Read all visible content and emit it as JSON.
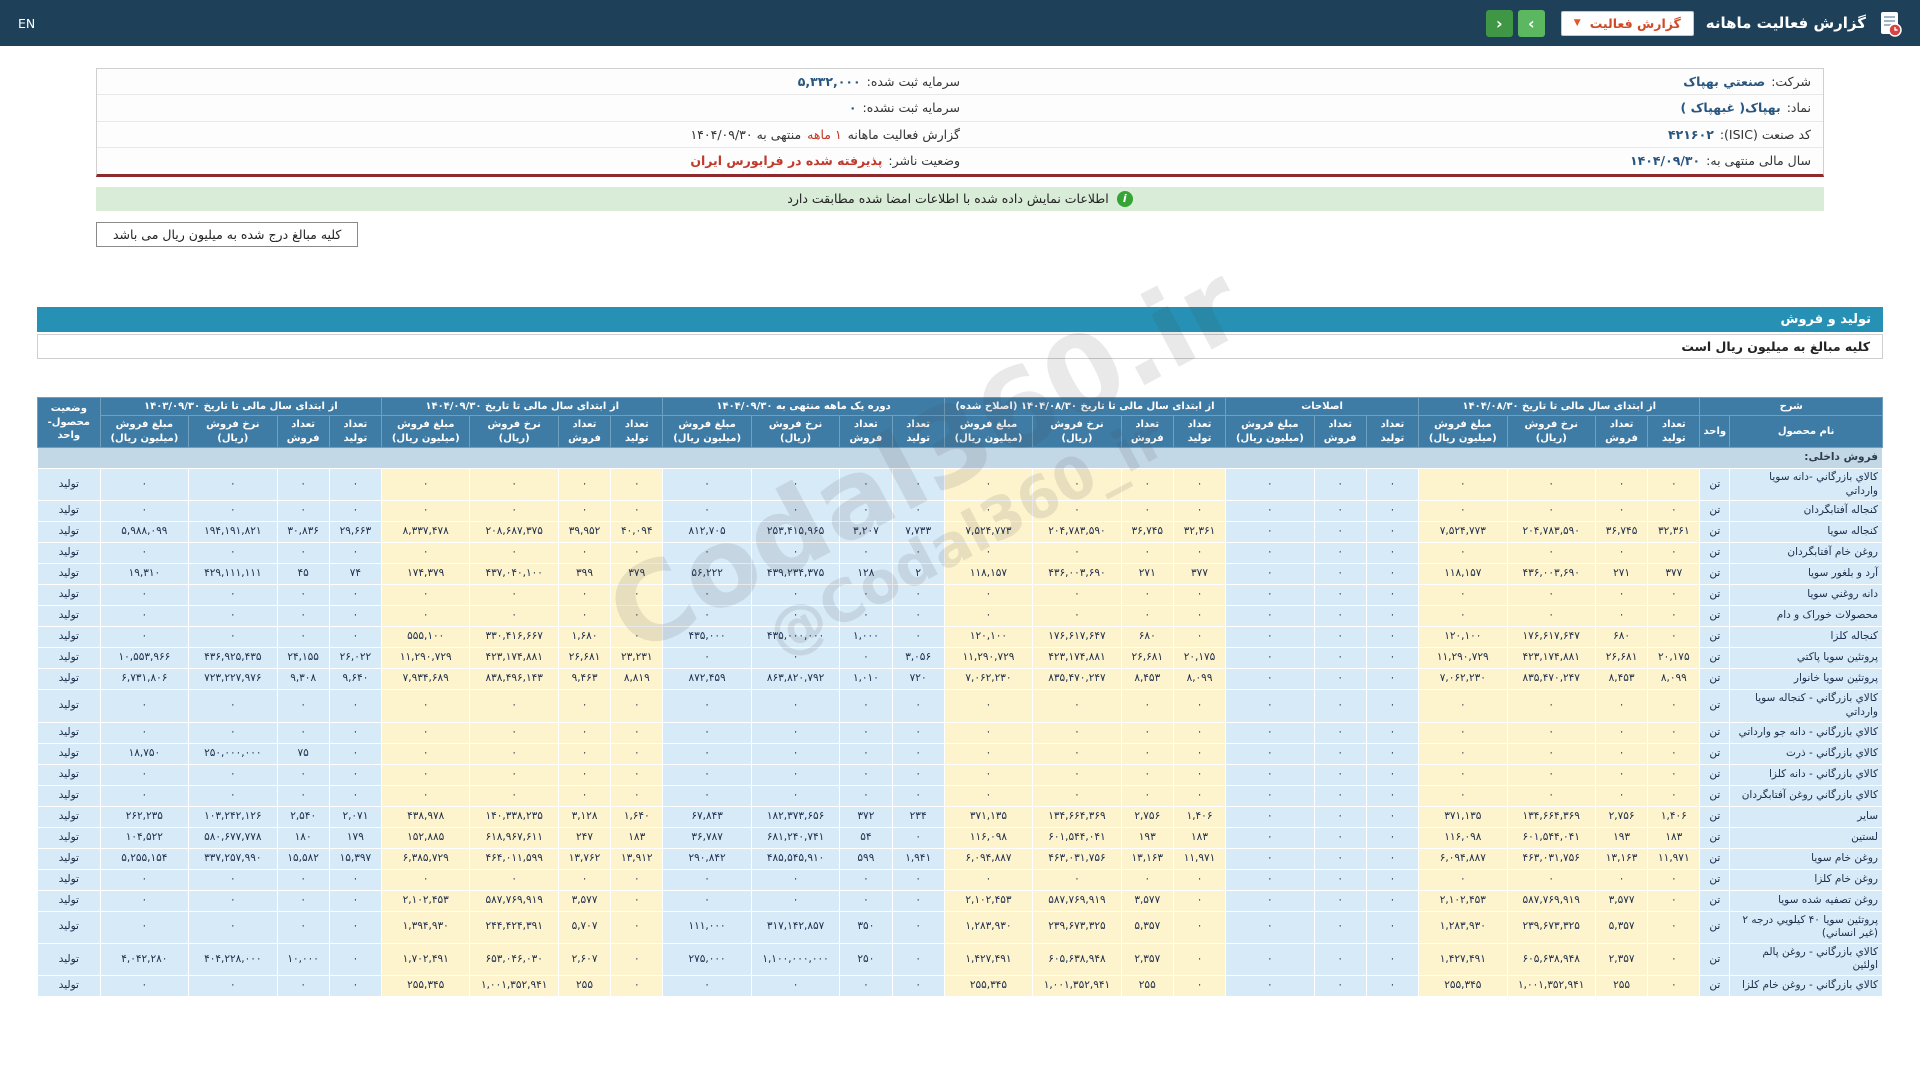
{
  "top_bar": {
    "lang": "EN",
    "title": "گزارش فعالیت ماهانه",
    "dropdown_label": "گزارش فعالیت",
    "dropdown_caret": "▼",
    "nav_next": "›",
    "nav_prev": "‹"
  },
  "company": {
    "rows": [
      {
        "right": {
          "label": "شرکت:",
          "value": "صنعتي بهپاک"
        },
        "left": {
          "label": "سرمایه ثبت شده:",
          "value": "۵,۳۳۲,۰۰۰"
        }
      },
      {
        "right": {
          "label": "نماد:",
          "value": "بهپاک( غبهپاک )"
        },
        "left": {
          "label": "سرمایه ثبت نشده:",
          "value": "۰"
        }
      },
      {
        "right": {
          "label": "کد صنعت (ISIC):",
          "value": "۴۲۱۶۰۲"
        },
        "left": {
          "label": "گزارش فعالیت ماهانه",
          "period": "۱ ماهه",
          "value2": "منتهی به ۱۴۰۴/۰۹/۳۰"
        }
      },
      {
        "right": {
          "label": "سال مالی منتهی به:",
          "value": "۱۴۰۴/۰۹/۳۰"
        },
        "left": {
          "label": "وضعیت ناشر:",
          "value": "پذيرفته شده در فرابورس ايران"
        }
      }
    ]
  },
  "notices": {
    "signed": "اطلاعات نمایش داده شده با اطلاعات امضا شده مطابقت دارد",
    "info_icon": "i",
    "amounts_box": "کلیه مبالغ درج شده به میلیون ریال می باشد"
  },
  "section": {
    "title": "تولید و فروش",
    "amounts_note": "کلیه مبالغ به میلیون ریال است"
  },
  "watermark": {
    "line1": "Codal360.ir",
    "line2": "@Codal360_ir"
  },
  "table": {
    "caption_col": {
      "top": "شرح",
      "name": "نام محصول",
      "unit": "واحد"
    },
    "status_col": "وضعیت محصول-واحد",
    "section_row": "فروش داخلی:",
    "groups": [
      {
        "label": "از ابتدای سال مالی تا تاریخ ۱۴۰۴/۰۸/۳۰",
        "tone": "cream",
        "cols": [
          "تعداد تولید",
          "تعداد فروش",
          "نرخ فروش (ریال)",
          "مبلغ فروش (میلیون ریال)"
        ]
      },
      {
        "label": "اصلاحات",
        "tone": "blue",
        "cols": [
          "تعداد تولید",
          "تعداد فروش",
          "مبلغ فروش (میلیون ریال)"
        ]
      },
      {
        "label": "از ابتدای سال مالی تا تاریخ ۱۴۰۴/۰۸/۳۰ (اصلاح شده)",
        "tone": "cream",
        "cols": [
          "تعداد تولید",
          "تعداد فروش",
          "نرخ فروش (ریال)",
          "مبلغ فروش (میلیون ریال)"
        ]
      },
      {
        "label": "دوره یک ماهه منتهی به ۱۴۰۴/۰۹/۳۰",
        "tone": "blue",
        "cols": [
          "تعداد تولید",
          "تعداد فروش",
          "نرخ فروش (ریال)",
          "مبلغ فروش (میلیون ریال)"
        ]
      },
      {
        "label": "از ابتدای سال مالی تا تاریخ ۱۴۰۴/۰۹/۳۰",
        "tone": "cream",
        "cols": [
          "تعداد تولید",
          "تعداد فروش",
          "نرخ فروش (ریال)",
          "مبلغ فروش (میلیون ریال)"
        ]
      },
      {
        "label": "از ابتدای سال مالی تا تاریخ ۱۴۰۳/۰۹/۳۰",
        "tone": "blue",
        "cols": [
          "تعداد تولید",
          "تعداد فروش",
          "نرخ فروش (ریال)",
          "مبلغ فروش (میلیون ریال)"
        ]
      }
    ],
    "rows": [
      {
        "name": "کالاي بازرگاني -دانه سويا وارداتي",
        "unit": "تن",
        "status": "تولید",
        "values": [
          "۰",
          "۰",
          "۰",
          "۰",
          "۰",
          "۰",
          "۰",
          "۰",
          "۰",
          "۰",
          "۰",
          "۰",
          "۰",
          "۰",
          "۰",
          "۰",
          "۰",
          "۰",
          "۰",
          "۰",
          "۰",
          "۰",
          "۰"
        ]
      },
      {
        "name": "کنجاله آفتابگردان",
        "unit": "تن",
        "status": "تولید",
        "values": [
          "۰",
          "۰",
          "۰",
          "۰",
          "۰",
          "۰",
          "۰",
          "۰",
          "۰",
          "۰",
          "۰",
          "۰",
          "۰",
          "۰",
          "۰",
          "۰",
          "۰",
          "۰",
          "۰",
          "۰",
          "۰",
          "۰",
          "۰"
        ]
      },
      {
        "name": "کنجاله سويا",
        "unit": "تن",
        "status": "تولید",
        "values": [
          "۳۲,۳۶۱",
          "۳۶,۷۴۵",
          "۲۰۴,۷۸۳,۵۹۰",
          "۷,۵۲۴,۷۷۳",
          "۰",
          "۰",
          "۰",
          "۳۲,۳۶۱",
          "۳۶,۷۴۵",
          "۲۰۴,۷۸۳,۵۹۰",
          "۷,۵۲۴,۷۷۳",
          "۷,۷۳۳",
          "۳,۲۰۷",
          "۲۵۳,۴۱۵,۹۶۵",
          "۸۱۲,۷۰۵",
          "۴۰,۰۹۴",
          "۳۹,۹۵۲",
          "۲۰۸,۶۸۷,۳۷۵",
          "۸,۳۳۷,۴۷۸",
          "۲۹,۶۶۳",
          "۳۰,۸۳۶",
          "۱۹۴,۱۹۱,۸۲۱",
          "۵,۹۸۸,۰۹۹"
        ]
      },
      {
        "name": "روغن خام آفتابگردان",
        "unit": "تن",
        "status": "تولید",
        "values": [
          "۰",
          "۰",
          "۰",
          "۰",
          "۰",
          "۰",
          "۰",
          "۰",
          "۰",
          "۰",
          "۰",
          "۰",
          "۰",
          "۰",
          "۰",
          "۰",
          "۰",
          "۰",
          "۰",
          "۰",
          "۰",
          "۰",
          "۰"
        ]
      },
      {
        "name": "آرد و بلغور سويا",
        "unit": "تن",
        "status": "تولید",
        "values": [
          "۳۷۷",
          "۲۷۱",
          "۴۳۶,۰۰۳,۶۹۰",
          "۱۱۸,۱۵۷",
          "۰",
          "۰",
          "۰",
          "۳۷۷",
          "۲۷۱",
          "۴۳۶,۰۰۳,۶۹۰",
          "۱۱۸,۱۵۷",
          "۲",
          "۱۲۸",
          "۴۳۹,۲۳۴,۳۷۵",
          "۵۶,۲۲۲",
          "۳۷۹",
          "۳۹۹",
          "۴۳۷,۰۴۰,۱۰۰",
          "۱۷۴,۳۷۹",
          "۷۴",
          "۴۵",
          "۴۲۹,۱۱۱,۱۱۱",
          "۱۹,۳۱۰"
        ]
      },
      {
        "name": "دانه روغني سويا",
        "unit": "تن",
        "status": "تولید",
        "values": [
          "۰",
          "۰",
          "۰",
          "۰",
          "۰",
          "۰",
          "۰",
          "۰",
          "۰",
          "۰",
          "۰",
          "۰",
          "۰",
          "۰",
          "۰",
          "۰",
          "۰",
          "۰",
          "۰",
          "۰",
          "۰",
          "۰",
          "۰"
        ]
      },
      {
        "name": "محصولات خوراک و دام",
        "unit": "تن",
        "status": "تولید",
        "values": [
          "۰",
          "۰",
          "۰",
          "۰",
          "۰",
          "۰",
          "۰",
          "۰",
          "۰",
          "۰",
          "۰",
          "۰",
          "۰",
          "۰",
          "۰",
          "۰",
          "۰",
          "۰",
          "۰",
          "۰",
          "۰",
          "۰",
          "۰"
        ]
      },
      {
        "name": "کنجاله کلزا",
        "unit": "تن",
        "status": "تولید",
        "values": [
          "۰",
          "۶۸۰",
          "۱۷۶,۶۱۷,۶۴۷",
          "۱۲۰,۱۰۰",
          "۰",
          "۰",
          "۰",
          "۰",
          "۶۸۰",
          "۱۷۶,۶۱۷,۶۴۷",
          "۱۲۰,۱۰۰",
          "۰",
          "۱,۰۰۰",
          "۴۳۵,۰۰۰,۰۰۰",
          "۴۳۵,۰۰۰",
          "۰",
          "۱,۶۸۰",
          "۳۳۰,۴۱۶,۶۶۷",
          "۵۵۵,۱۰۰",
          "۰",
          "۰",
          "۰",
          "۰"
        ]
      },
      {
        "name": "پروتئين سويا پاکتي",
        "unit": "تن",
        "status": "تولید",
        "values": [
          "۲۰,۱۷۵",
          "۲۶,۶۸۱",
          "۴۲۳,۱۷۴,۸۸۱",
          "۱۱,۲۹۰,۷۲۹",
          "۰",
          "۰",
          "۰",
          "۲۰,۱۷۵",
          "۲۶,۶۸۱",
          "۴۲۳,۱۷۴,۸۸۱",
          "۱۱,۲۹۰,۷۲۹",
          "۳,۰۵۶",
          "۰",
          "۰",
          "۰",
          "۲۳,۲۳۱",
          "۲۶,۶۸۱",
          "۴۲۳,۱۷۴,۸۸۱",
          "۱۱,۲۹۰,۷۲۹",
          "۲۶,۰۲۲",
          "۲۴,۱۵۵",
          "۴۳۶,۹۲۵,۴۳۵",
          "۱۰,۵۵۳,۹۶۶"
        ]
      },
      {
        "name": "پروتئين سويا خانوار",
        "unit": "تن",
        "status": "تولید",
        "values": [
          "۸,۰۹۹",
          "۸,۴۵۳",
          "۸۳۵,۴۷۰,۲۴۷",
          "۷,۰۶۲,۲۳۰",
          "۰",
          "۰",
          "۰",
          "۸,۰۹۹",
          "۸,۴۵۳",
          "۸۳۵,۴۷۰,۲۴۷",
          "۷,۰۶۲,۲۳۰",
          "۷۲۰",
          "۱,۰۱۰",
          "۸۶۳,۸۲۰,۷۹۲",
          "۸۷۲,۴۵۹",
          "۸,۸۱۹",
          "۹,۴۶۳",
          "۸۳۸,۴۹۶,۱۴۳",
          "۷,۹۳۴,۶۸۹",
          "۹,۶۴۰",
          "۹,۳۰۸",
          "۷۲۳,۲۲۷,۹۷۶",
          "۶,۷۳۱,۸۰۶"
        ]
      },
      {
        "name": "کالاي بازرگاني - کنجاله سويا وارداتي",
        "unit": "تن",
        "status": "تولید",
        "values": [
          "۰",
          "۰",
          "۰",
          "۰",
          "۰",
          "۰",
          "۰",
          "۰",
          "۰",
          "۰",
          "۰",
          "۰",
          "۰",
          "۰",
          "۰",
          "۰",
          "۰",
          "۰",
          "۰",
          "۰",
          "۰",
          "۰",
          "۰"
        ]
      },
      {
        "name": "کالاي بازرگاني - دانه جو وارداتي",
        "unit": "تن",
        "status": "تولید",
        "values": [
          "۰",
          "۰",
          "۰",
          "۰",
          "۰",
          "۰",
          "۰",
          "۰",
          "۰",
          "۰",
          "۰",
          "۰",
          "۰",
          "۰",
          "۰",
          "۰",
          "۰",
          "۰",
          "۰",
          "۰",
          "۰",
          "۰",
          "۰"
        ]
      },
      {
        "name": "کالاي بازرگاني - ذرت",
        "unit": "تن",
        "status": "تولید",
        "values": [
          "۰",
          "۰",
          "۰",
          "۰",
          "۰",
          "۰",
          "۰",
          "۰",
          "۰",
          "۰",
          "۰",
          "۰",
          "۰",
          "۰",
          "۰",
          "۰",
          "۰",
          "۰",
          "۰",
          "۰",
          "۷۵",
          "۲۵۰,۰۰۰,۰۰۰",
          "۱۸,۷۵۰"
        ]
      },
      {
        "name": "کالاي بازرگاني - دانه کلزا",
        "unit": "تن",
        "status": "تولید",
        "values": [
          "۰",
          "۰",
          "۰",
          "۰",
          "۰",
          "۰",
          "۰",
          "۰",
          "۰",
          "۰",
          "۰",
          "۰",
          "۰",
          "۰",
          "۰",
          "۰",
          "۰",
          "۰",
          "۰",
          "۰",
          "۰",
          "۰",
          "۰"
        ]
      },
      {
        "name": "کالاي بازرگاني روغن آفتابگردان",
        "unit": "تن",
        "status": "تولید",
        "values": [
          "۰",
          "۰",
          "۰",
          "۰",
          "۰",
          "۰",
          "۰",
          "۰",
          "۰",
          "۰",
          "۰",
          "۰",
          "۰",
          "۰",
          "۰",
          "۰",
          "۰",
          "۰",
          "۰",
          "۰",
          "۰",
          "۰",
          "۰"
        ]
      },
      {
        "name": "ساير",
        "unit": "تن",
        "status": "تولید",
        "values": [
          "۱,۴۰۶",
          "۲,۷۵۶",
          "۱۳۴,۶۶۴,۳۶۹",
          "۳۷۱,۱۳۵",
          "۰",
          "۰",
          "۰",
          "۱,۴۰۶",
          "۲,۷۵۶",
          "۱۳۴,۶۶۴,۳۶۹",
          "۳۷۱,۱۳۵",
          "۲۳۴",
          "۳۷۲",
          "۱۸۲,۳۷۳,۶۵۶",
          "۶۷,۸۴۳",
          "۱,۶۴۰",
          "۳,۱۲۸",
          "۱۴۰,۳۳۸,۲۳۵",
          "۴۳۸,۹۷۸",
          "۲,۰۷۱",
          "۲,۵۴۰",
          "۱۰۳,۲۴۲,۱۲۶",
          "۲۶۲,۲۳۵"
        ]
      },
      {
        "name": "لستين",
        "unit": "تن",
        "status": "تولید",
        "values": [
          "۱۸۳",
          "۱۹۳",
          "۶۰۱,۵۴۴,۰۴۱",
          "۱۱۶,۰۹۸",
          "۰",
          "۰",
          "۰",
          "۱۸۳",
          "۱۹۳",
          "۶۰۱,۵۴۴,۰۴۱",
          "۱۱۶,۰۹۸",
          "۰",
          "۵۴",
          "۶۸۱,۲۴۰,۷۴۱",
          "۳۶,۷۸۷",
          "۱۸۳",
          "۲۴۷",
          "۶۱۸,۹۶۷,۶۱۱",
          "۱۵۲,۸۸۵",
          "۱۷۹",
          "۱۸۰",
          "۵۸۰,۶۷۷,۷۷۸",
          "۱۰۴,۵۲۲"
        ]
      },
      {
        "name": "روغن خام سويا",
        "unit": "تن",
        "status": "تولید",
        "values": [
          "۱۱,۹۷۱",
          "۱۳,۱۶۳",
          "۴۶۳,۰۳۱,۷۵۶",
          "۶,۰۹۴,۸۸۷",
          "۰",
          "۰",
          "۰",
          "۱۱,۹۷۱",
          "۱۳,۱۶۳",
          "۴۶۳,۰۳۱,۷۵۶",
          "۶,۰۹۴,۸۸۷",
          "۱,۹۴۱",
          "۵۹۹",
          "۴۸۵,۵۴۵,۹۱۰",
          "۲۹۰,۸۴۲",
          "۱۳,۹۱۲",
          "۱۳,۷۶۲",
          "۴۶۴,۰۱۱,۵۹۹",
          "۶,۳۸۵,۷۲۹",
          "۱۵,۳۹۷",
          "۱۵,۵۸۲",
          "۳۳۷,۲۵۷,۹۹۰",
          "۵,۲۵۵,۱۵۴"
        ]
      },
      {
        "name": "روغن خام کلزا",
        "unit": "تن",
        "status": "تولید",
        "values": [
          "۰",
          "۰",
          "۰",
          "۰",
          "۰",
          "۰",
          "۰",
          "۰",
          "۰",
          "۰",
          "۰",
          "۰",
          "۰",
          "۰",
          "۰",
          "۰",
          "۰",
          "۰",
          "۰",
          "۰",
          "۰",
          "۰",
          "۰"
        ]
      },
      {
        "name": "روغن تصفيه شده سويا",
        "unit": "تن",
        "status": "تولید",
        "values": [
          "۰",
          "۳,۵۷۷",
          "۵۸۷,۷۶۹,۹۱۹",
          "۲,۱۰۲,۴۵۳",
          "۰",
          "۰",
          "۰",
          "۰",
          "۳,۵۷۷",
          "۵۸۷,۷۶۹,۹۱۹",
          "۲,۱۰۲,۴۵۳",
          "۰",
          "۰",
          "۰",
          "۰",
          "۰",
          "۳,۵۷۷",
          "۵۸۷,۷۶۹,۹۱۹",
          "۲,۱۰۲,۴۵۳",
          "۰",
          "۰",
          "۰",
          "۰"
        ]
      },
      {
        "name": "پروتئين سويا ۴۰ کيلويي درجه ۲ (غير انساني)",
        "unit": "تن",
        "status": "تولید",
        "values": [
          "۰",
          "۵,۳۵۷",
          "۲۳۹,۶۷۳,۳۲۵",
          "۱,۲۸۳,۹۳۰",
          "۰",
          "۰",
          "۰",
          "۰",
          "۵,۳۵۷",
          "۲۳۹,۶۷۳,۳۲۵",
          "۱,۲۸۳,۹۳۰",
          "۰",
          "۳۵۰",
          "۳۱۷,۱۴۲,۸۵۷",
          "۱۱۱,۰۰۰",
          "۰",
          "۵,۷۰۷",
          "۲۴۴,۴۲۴,۳۹۱",
          "۱,۳۹۴,۹۳۰",
          "۰",
          "۰",
          "۰",
          "۰"
        ]
      },
      {
        "name": "کالاي بازرگاني - روغن پالم اولئين",
        "unit": "تن",
        "status": "تولید",
        "values": [
          "۰",
          "۲,۳۵۷",
          "۶۰۵,۶۳۸,۹۴۸",
          "۱,۴۲۷,۴۹۱",
          "۰",
          "۰",
          "۰",
          "۰",
          "۲,۳۵۷",
          "۶۰۵,۶۳۸,۹۴۸",
          "۱,۴۲۷,۴۹۱",
          "۰",
          "۲۵۰",
          "۱,۱۰۰,۰۰۰,۰۰۰",
          "۲۷۵,۰۰۰",
          "۰",
          "۲,۶۰۷",
          "۶۵۳,۰۴۶,۰۳۰",
          "۱,۷۰۲,۴۹۱",
          "۰",
          "۱۰,۰۰۰",
          "۴۰۴,۲۲۸,۰۰۰",
          "۴,۰۴۲,۲۸۰"
        ]
      },
      {
        "name": "کالاي بازرگاني - روغن خام کلزا",
        "unit": "تن",
        "status": "تولید",
        "values": [
          "۰",
          "۲۵۵",
          "۱,۰۰۱,۳۵۲,۹۴۱",
          "۲۵۵,۳۴۵",
          "۰",
          "۰",
          "۰",
          "۰",
          "۲۵۵",
          "۱,۰۰۱,۳۵۲,۹۴۱",
          "۲۵۵,۳۴۵",
          "۰",
          "۰",
          "۰",
          "۰",
          "۰",
          "۲۵۵",
          "۱,۰۰۱,۳۵۲,۹۴۱",
          "۲۵۵,۳۴۵",
          "۰",
          "۰",
          "۰",
          "۰"
        ]
      }
    ]
  }
}
